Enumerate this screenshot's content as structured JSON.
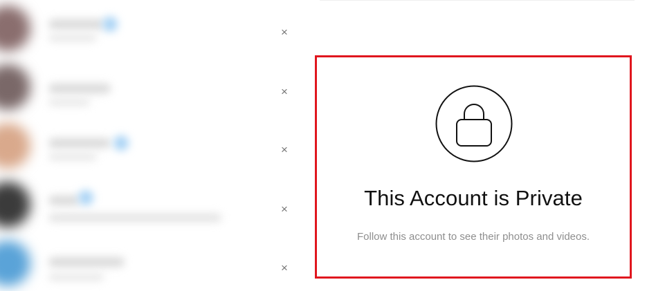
{
  "suggestions": {
    "dismiss_glyph": "×",
    "rows": [
      {
        "avatar_color": "#8a6e6e"
      },
      {
        "avatar_color": "#7a6868"
      },
      {
        "avatar_color": "#d9a98c"
      },
      {
        "avatar_color": "#3b3b3b"
      },
      {
        "avatar_color": "#5aa3d8"
      }
    ]
  },
  "private_notice": {
    "icon": "lock-icon",
    "title": "This Account is Private",
    "subtitle": "Follow this account to see their photos and videos."
  },
  "colors": {
    "highlight_border": "#e0161e",
    "title_text": "#111111",
    "subtitle_text": "#8e8e8e"
  }
}
